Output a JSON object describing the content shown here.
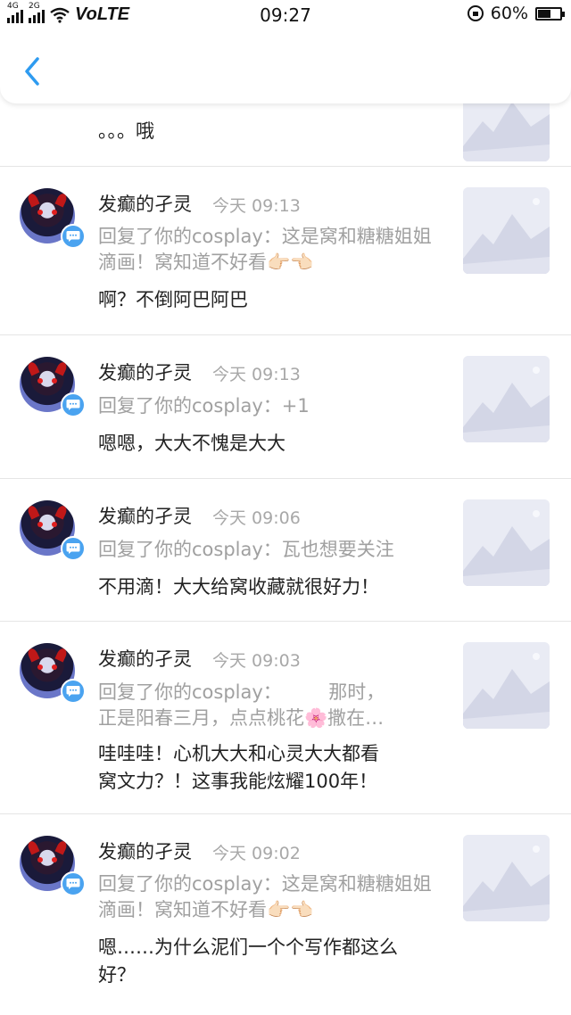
{
  "status_bar": {
    "network": "4G",
    "network2": "2G",
    "volte": "VoLTE",
    "time": "09:27",
    "battery": "60%",
    "battery_level": 0.6
  },
  "nav": {
    "back_icon": "chevron-left-icon",
    "accent": "#2e9bf0"
  },
  "partial_item": {
    "content": "。。。哦"
  },
  "comments": [
    {
      "user": "发癫的孑灵",
      "time": "今天 09:13",
      "reply": "回复了你的cosplay：这是窝和糖糖姐姐滴画！窝知道不好看👉🏻👈🏻",
      "content": "啊？不倒阿巴阿巴"
    },
    {
      "user": "发癫的孑灵",
      "time": "今天 09:13",
      "reply": "回复了你的cosplay：+1",
      "content": "嗯嗯，大大不愧是大大"
    },
    {
      "user": "发癫的孑灵",
      "time": "今天 09:06",
      "reply": "回复了你的cosplay：瓦也想要关注",
      "content": "不用滴！大大给窝收藏就很好力！"
    },
    {
      "user": "发癫的孑灵",
      "time": "今天 09:03",
      "reply": "回复了你的cosplay：　　　那时，\n正是阳春三月，点点桃花🌸撒在…",
      "content": "哇哇哇！心机大大和心灵大大都看\n窝文力？！这事我能炫耀100年！"
    },
    {
      "user": "发癫的孑灵",
      "time": "今天 09:02",
      "reply": "回复了你的cosplay：这是窝和糖糖姐姐滴画！窝知道不好看👉🏻👈🏻",
      "content": "嗯……为什么泥们一个个写作都这么\n好？"
    }
  ]
}
